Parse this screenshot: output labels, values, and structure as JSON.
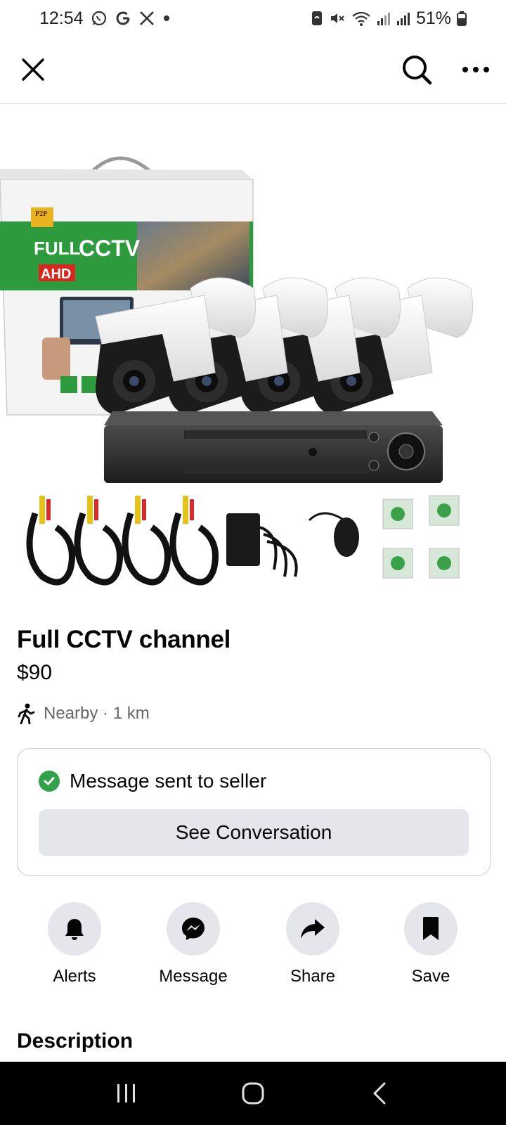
{
  "status_bar": {
    "time": "12:54",
    "battery": "51%",
    "icons": [
      "whatsapp-icon",
      "google-icon",
      "x-icon",
      "dot-icon",
      "nfc-icon",
      "mute-icon",
      "wifi-icon",
      "signal-icon",
      "signal-icon",
      "battery-icon"
    ]
  },
  "app_bar": {
    "icons": [
      "close-icon",
      "search-icon",
      "more-icon"
    ]
  },
  "product_image": {
    "box_text_1": "FULL",
    "box_text_2": "CCTV",
    "box_text_3": "AHD",
    "box_badge": "P2P"
  },
  "listing": {
    "title": "Full CCTV channel",
    "price": "$90",
    "location": "Nearby · 1 km"
  },
  "message_card": {
    "status": "Message sent to seller",
    "button_label": "See Conversation"
  },
  "actions": [
    {
      "label": "Alerts",
      "icon": "bell-icon"
    },
    {
      "label": "Message",
      "icon": "messenger-icon"
    },
    {
      "label": "Share",
      "icon": "share-icon"
    },
    {
      "label": "Save",
      "icon": "bookmark-icon"
    }
  ],
  "description_heading": "Description",
  "colors": {
    "accent_green": "#31a24c",
    "button_gray": "#e4e6eb",
    "text_secondary": "#65676b"
  }
}
